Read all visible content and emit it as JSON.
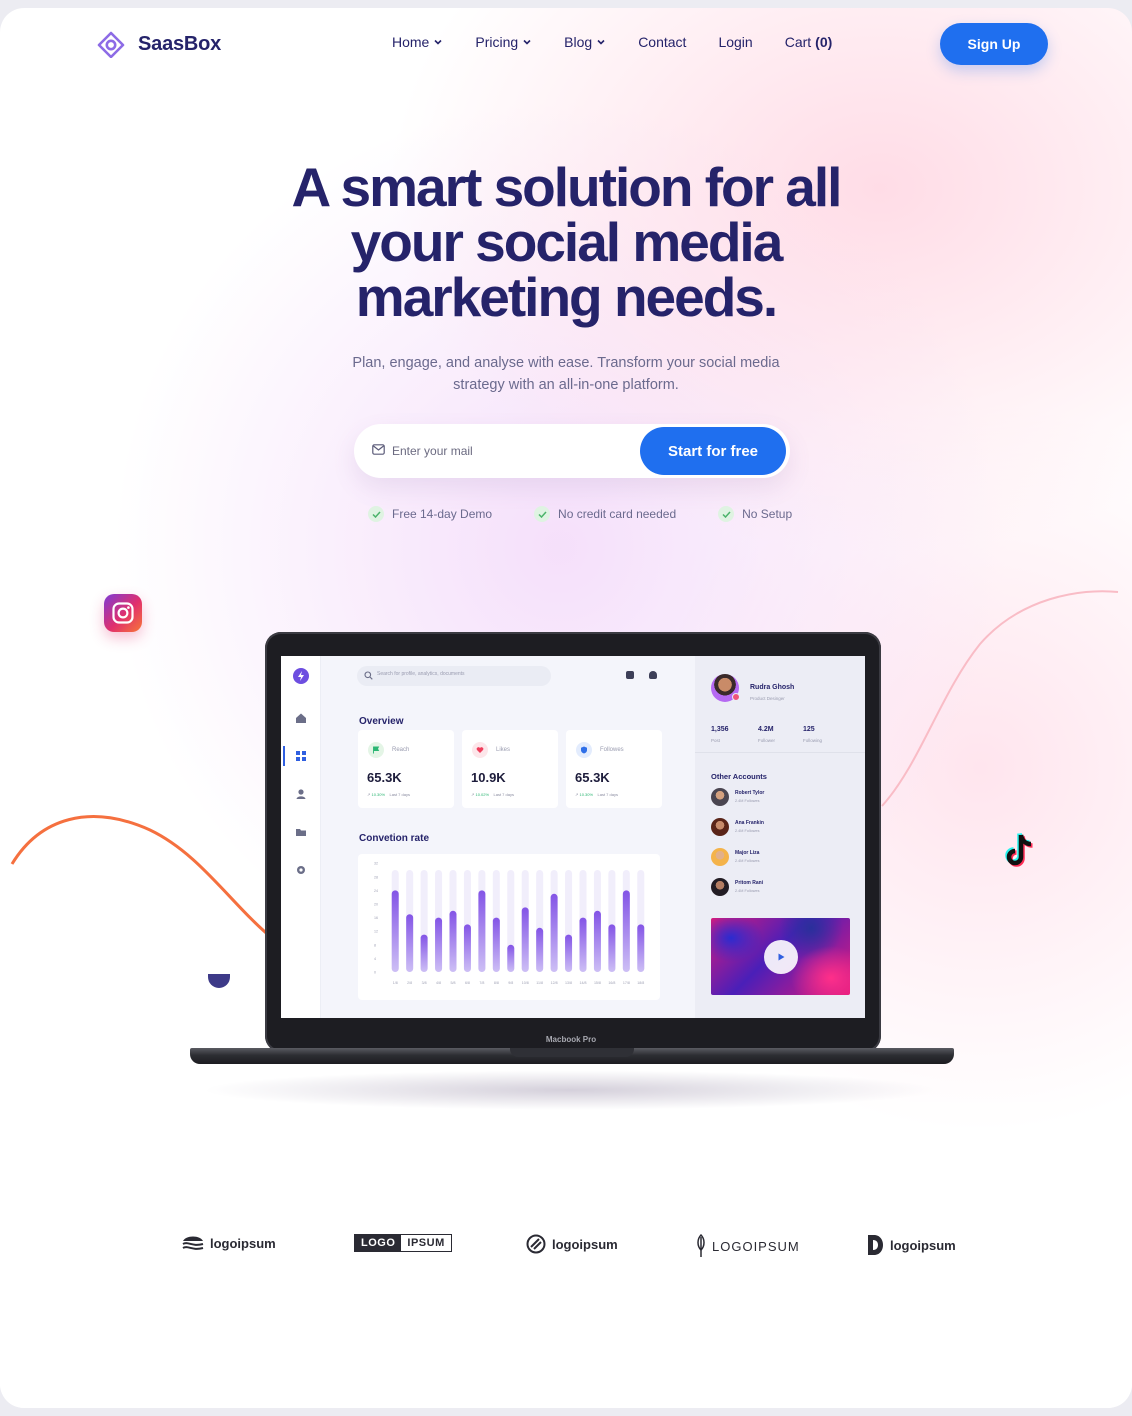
{
  "nav": {
    "brand": "SaasBox",
    "items": [
      {
        "label": "Home",
        "dropdown": true
      },
      {
        "label": "Pricing",
        "dropdown": true
      },
      {
        "label": "Blog",
        "dropdown": true
      },
      {
        "label": "Contact",
        "dropdown": false
      },
      {
        "label": "Login",
        "dropdown": false
      },
      {
        "label": "Cart",
        "dropdown": false
      }
    ],
    "cart_count": "(0)",
    "signup_label": "Sign Up"
  },
  "hero": {
    "title_line1": "A smart solution for all",
    "title_line2": "your social media",
    "title_line3": "marketing needs.",
    "subtitle_line1": "Plan, engage, and analyse with ease. Transform your social media",
    "subtitle_line2": "strategy with an all-in-one platform.",
    "email_placeholder": "Enter your mail",
    "cta_label": "Start for free",
    "perks": [
      "Free 14-day Demo",
      "No credit card needed",
      "No Setup"
    ]
  },
  "dashboard": {
    "search_placeholder": "Search for profile, analytics, documents",
    "overview_title": "Overview",
    "cards": [
      {
        "label": "Reach",
        "value": "65.3K",
        "change": "10.30%",
        "period": "Last 7 days",
        "icon": "flag-icon",
        "icon_bg": "#e4f5e6",
        "icon_color": "#2bb673"
      },
      {
        "label": "Likes",
        "value": "10.9K",
        "change": "10.02%",
        "period": "Last 7 days",
        "icon": "heart-icon",
        "icon_bg": "#fde6ea",
        "icon_color": "#ef3e5c"
      },
      {
        "label": "Followes",
        "value": "65.3K",
        "change": "10.30%",
        "period": "Last 7 days",
        "icon": "shield-icon",
        "icon_bg": "#e3ecfd",
        "icon_color": "#2f6fe8"
      }
    ],
    "conversion_title": "Convetion rate",
    "profile": {
      "name": "Rudra Ghosh",
      "role": "Product Desinger",
      "stats": [
        {
          "value": "1,356",
          "label": "Post"
        },
        {
          "value": "4.2M",
          "label": "Follower"
        },
        {
          "value": "125",
          "label": "Following"
        }
      ]
    },
    "other_accounts_title": "Other Accounts",
    "accounts": [
      {
        "name": "Robert Tylor",
        "followers": "2.4M Followes"
      },
      {
        "name": "Ana Frankin",
        "followers": "2.4M Followes"
      },
      {
        "name": "Major Liza",
        "followers": "2.4M Followes"
      },
      {
        "name": "Pritom Rani",
        "followers": "2.4M Followes"
      }
    ],
    "laptop_label": "Macbook Pro"
  },
  "chart_data": {
    "type": "bar",
    "title": "Convetion rate",
    "categories": [
      "1/8",
      "2/8",
      "3/8",
      "4/8",
      "5/8",
      "6/8",
      "7/8",
      "8/8",
      "9/8",
      "10/8",
      "11/8",
      "12/8",
      "13/8",
      "14/8",
      "15/8",
      "16/8",
      "17/8",
      "18/8"
    ],
    "values": [
      24,
      17,
      11,
      16,
      18,
      14,
      24,
      16,
      8,
      19,
      13,
      23,
      11,
      16,
      18,
      14,
      24,
      14
    ],
    "ylim": [
      0,
      30
    ],
    "yticks": [
      0,
      4,
      8,
      12,
      16,
      20,
      24,
      28,
      32
    ],
    "grid": false
  },
  "logos": [
    "logoipsum",
    "LOGO",
    "IPSUM",
    "logoipsum",
    "LOGOIPSUM",
    "logoipsum"
  ],
  "colors": {
    "primary": "#1f6fef",
    "heading": "#25236a",
    "bar": "#8e63e6"
  }
}
